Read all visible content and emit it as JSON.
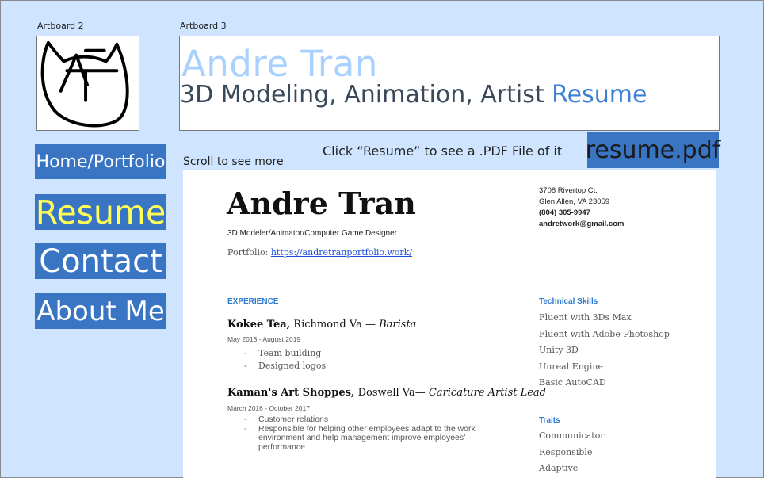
{
  "artboards": {
    "left_label": "Artboard 2",
    "right_label": "Artboard 3"
  },
  "logo": {
    "icon": "handdrawn-AT-cat-logo"
  },
  "header": {
    "name": "Andre Tran",
    "subtitle_main": "3D Modeling, Animation, Artist",
    "subtitle_accent": "Resume"
  },
  "nav": {
    "home": "Home/Portfolio",
    "resume": "Resume",
    "contact": "Contact",
    "about": "About Me"
  },
  "hints": {
    "click": "Click “Resume” to see a .PDF File of it",
    "scroll": "Scroll to see more",
    "pdf_button": "resume.pdf"
  },
  "resume": {
    "name": "Andre Tran",
    "role": "3D Modeler/Animator/Computer Game Designer",
    "portfolio_label": "Portfolio:",
    "portfolio_link": "https://andretranportfolio.work/",
    "address_line1": "3708 Rivertop Ct.",
    "address_line2": "Glen Allen, VA 23059",
    "phone": "(804) 305-9947",
    "email": "andretwork@gmail.com",
    "experience_title": "EXPERIENCE",
    "job1": {
      "company": "Kokee Tea,",
      "location": " Richmond Va — ",
      "position": "Barista",
      "dates": "May 2018 - August 2019",
      "bullets": [
        "Team building",
        "Designed logos"
      ]
    },
    "job2": {
      "company": "Kaman's Art Shoppes,",
      "location": " Doswell Va— ",
      "position": "Caricature Artist Lead",
      "dates": "March 2016 - October 2017",
      "bullets": [
        "Customer relations",
        "Responsible for helping other employees adapt to the work environment and help management improve employees’ performance"
      ]
    },
    "tech_title": "Technical Skills",
    "tech_skills": [
      "Fluent with 3Ds Max",
      "Fluent with Adobe Photoshop",
      "Unity 3D",
      "Unreal Engine",
      "Basic AutoCAD"
    ],
    "traits_title": "Traits",
    "traits": [
      "Communicator",
      "Responsible",
      "Adaptive"
    ]
  },
  "colors": {
    "background": "#cfe5ff",
    "nav_button": "#3a75c4",
    "active_nav_text": "#ffff55",
    "name_light_blue": "#a9d1ff",
    "section_blue": "#2f7bd0"
  }
}
